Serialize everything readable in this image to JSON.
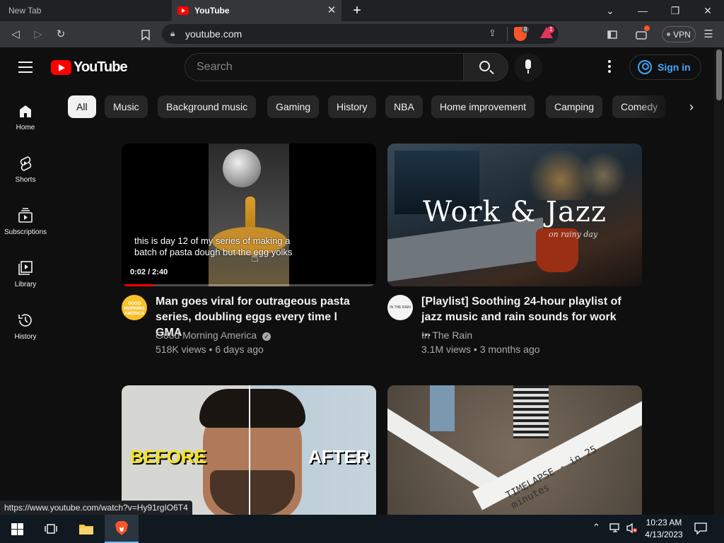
{
  "browser": {
    "tabs": [
      {
        "label": "New Tab",
        "active": false
      },
      {
        "label": "YouTube",
        "active": true
      }
    ],
    "url": "youtube.com",
    "shield_badge": "8",
    "rewards_badge": "1",
    "vpn_label": "VPN",
    "status_url": "https://www.youtube.com/watch?v=Hy91rgIO6T4",
    "accent_colors": {
      "brave": "#fb542b",
      "youtube_red": "#ff0000",
      "link_blue": "#3ea6ff"
    }
  },
  "youtube": {
    "logo_text": "YouTube",
    "search_placeholder": "Search",
    "signin_label": "Sign in",
    "chips": [
      "All",
      "Music",
      "Background music",
      "Gaming",
      "History",
      "NBA",
      "Home improvement",
      "Camping",
      "Comedy"
    ],
    "guide": [
      {
        "label": "Home",
        "icon": "home-icon"
      },
      {
        "label": "Shorts",
        "icon": "shorts-icon"
      },
      {
        "label": "Subscriptions",
        "icon": "subscriptions-icon"
      },
      {
        "label": "Library",
        "icon": "library-icon"
      },
      {
        "label": "History",
        "icon": "history-icon"
      }
    ],
    "videos": [
      {
        "title": "Man goes viral for outrageous pasta series, doubling eggs every time l GMA",
        "channel": "Good Morning America",
        "verified": true,
        "meta": "518K views • 6 days ago",
        "caption": "this is day 12 of my series of making a batch of pasta dough but the egg yolks",
        "time": "0:02 / 2:40",
        "progress": 0.0125,
        "avatar_text": "GOOD MORNING AMERICA"
      },
      {
        "title": "[Playlist] Soothing 24-hour playlist of jazz music and rain sounds for work ...",
        "channel": "In The Rain",
        "verified": false,
        "meta": "3.1M views • 3 months ago",
        "overlay_title": "Work & Jazz",
        "overlay_sub": "on rainy day",
        "avatar_text": "IN THE RAIN"
      },
      {
        "overlay_left": "BEFORE",
        "overlay_right": "AFTER"
      },
      {
        "overlay_text": "TIMELAPSE - in 25 minutes"
      }
    ]
  },
  "taskbar": {
    "time": "10:23 AM",
    "date": "4/13/2023"
  }
}
